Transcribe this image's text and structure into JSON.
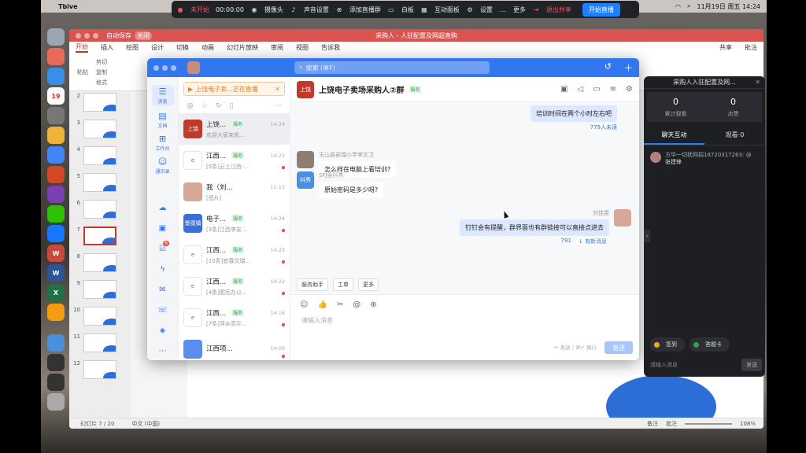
{
  "menubar": {
    "app": "Tbive",
    "datetime": "11月19日 周五 14:24"
  },
  "livebar": {
    "status": "未开始",
    "timer": "00:00:00",
    "items": [
      "摄像头",
      "声音设置",
      "添加直播群",
      "白板",
      "互动面板",
      "设置",
      "更多"
    ],
    "share": "退出共享",
    "start": "开始直播"
  },
  "ppt": {
    "autosave": "自动保存",
    "autosave_state": "关闭",
    "title": "采购人 - 人驻配置及网超直购",
    "tabs": [
      "开始",
      "插入",
      "绘图",
      "设计",
      "切换",
      "动画",
      "幻灯片放映",
      "审阅",
      "视图"
    ],
    "tellme": "告诉我",
    "share": "共享",
    "comment": "批注",
    "paste": "粘贴",
    "clip": [
      "剪切",
      "复制",
      "格式"
    ],
    "slides": [
      "2",
      "3",
      "4",
      "5",
      "6",
      "7",
      "8",
      "9",
      "10",
      "11",
      "12"
    ],
    "selected_slide": "7",
    "status_slide": "幻灯片 7 / 20",
    "status_lang": "中文 (中国)",
    "notes": "备注",
    "comments": "批注",
    "zoom": "108%"
  },
  "dt": {
    "search_placeholder": "搜索 (⌘F)",
    "nav": [
      {
        "icon": "☰",
        "label": "消息"
      },
      {
        "icon": "▤",
        "label": "文档"
      },
      {
        "icon": "⊞",
        "label": "工作台"
      },
      {
        "icon": "☺",
        "label": "通讯录"
      }
    ],
    "nav_badge": "6",
    "live_chip": "上饶电子卖...正在直播",
    "conversations": [
      {
        "avatar": "上饶",
        "color": "#c0392b",
        "name": "上饶...",
        "tag": "服务",
        "time": "14:24",
        "preview": "欢迎大家来观..."
      },
      {
        "avatar": "e",
        "color": "#ffffff",
        "name": "江西...",
        "tag": "服务",
        "time": "14:22",
        "preview": "[5条]云上江西-..."
      },
      {
        "avatar": "",
        "color": "#d7a79a",
        "name": "我（刘佳雯）",
        "tag": "",
        "time": "11-15",
        "preview": "[图片]"
      },
      {
        "avatar": "景德镇",
        "color": "#3a6fd8",
        "name": "电子...",
        "tag": "服务",
        "time": "14:24",
        "preview": "[3条]江西李友..."
      },
      {
        "avatar": "e",
        "color": "#ffffff",
        "name": "江西...",
        "tag": "服务",
        "time": "14:23",
        "preview": "[10条]宜春文瑞..."
      },
      {
        "avatar": "e",
        "color": "#ffffff",
        "name": "江西...",
        "tag": "服务",
        "time": "14:22",
        "preview": "[4条]肥宪办公..."
      },
      {
        "avatar": "e",
        "color": "#ffffff",
        "name": "江西...",
        "tag": "服务",
        "time": "14:16",
        "preview": "[7条]萍乡高平..."
      },
      {
        "avatar": "",
        "color": "#5b8def",
        "name": "江西项目...",
        "tag": "",
        "time": "14:09",
        "preview": ""
      }
    ],
    "chat": {
      "avatar": "上饶",
      "name": "上饶电子卖场采购人②群",
      "badge": "服务",
      "msg0": "培训时间在两个小时左右吧",
      "read0": "779人未读",
      "m1_sender": "玉山县岩瑞小学李文卫",
      "m1_text": "怎么样在电脑上看培训?",
      "m2_avatar": "抖秀",
      "m2_sender": "SFJ吴抖秀",
      "m2_text": "原始密码是多少呀?",
      "m3_sender": "刘佳雯",
      "m3_text": "钉钉会有提醒，群界面也有群链接可以直接点进去",
      "m3_read": "791",
      "new_msg": "↓ 有新消息",
      "quick": [
        "服务助手",
        "工单",
        "更多"
      ],
      "input_placeholder": "请输入消息",
      "hint": "↵ 发送 / ⌘↵ 换行",
      "send": "发送"
    }
  },
  "live": {
    "title": "采购人入驻配置及网...",
    "viewers": "0",
    "viewers_label": "累计观看",
    "likes": "0",
    "likes_label": "点赞",
    "tab_chat": "聊天互动",
    "tab_watch": "观看·0",
    "comment_meta": "方华一切抚网招18720317263: @",
    "comment_name": "张建锋",
    "sign": "签到",
    "answer": "答题卡",
    "input": "请输入消息",
    "send": "发送"
  }
}
